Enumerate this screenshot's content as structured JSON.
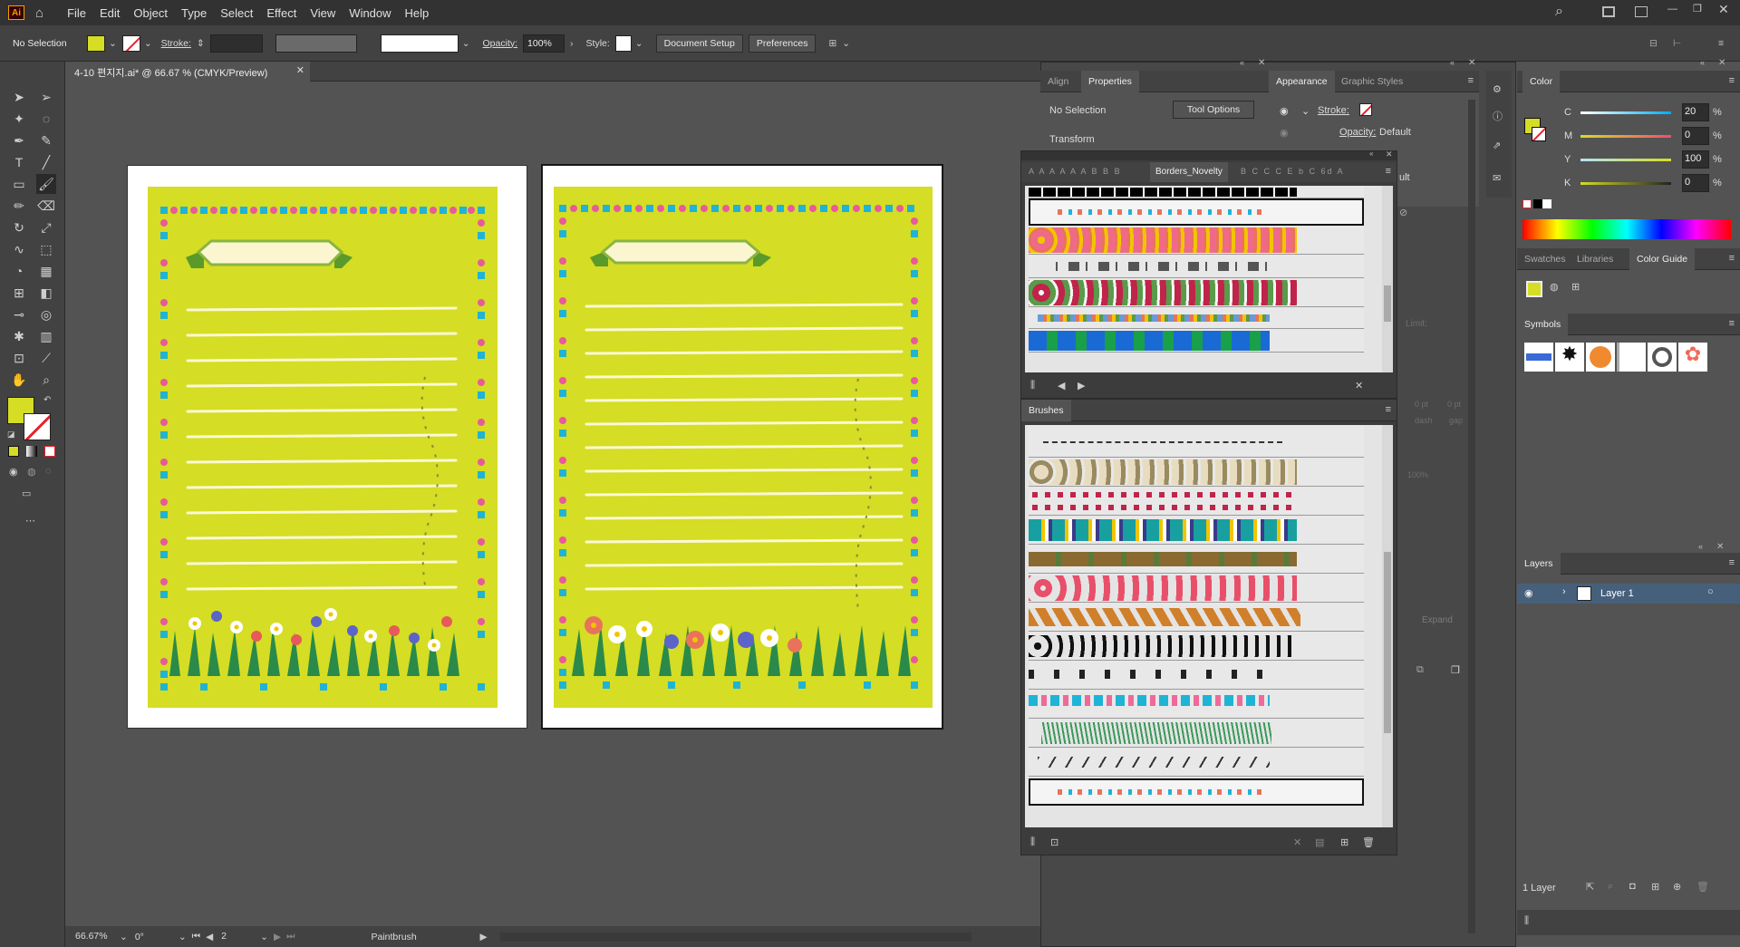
{
  "app": {
    "logo": "Ai",
    "home_icon": "home-icon"
  },
  "menu": [
    "File",
    "Edit",
    "Object",
    "Type",
    "Select",
    "Effect",
    "View",
    "Window",
    "Help"
  ],
  "control": {
    "selection": "No Selection",
    "stroke_label": "Stroke:",
    "opacity_label": "Opacity:",
    "opacity_value": "100%",
    "style_label": "Style:",
    "doc_setup": "Document Setup",
    "preferences": "Preferences"
  },
  "document": {
    "tab_title": "4-10 편지지.ai* @ 66.67 % (CMYK/Preview)"
  },
  "status": {
    "zoom": "66.67%",
    "rotate": "0°",
    "artboard": "2",
    "tool": "Paintbrush"
  },
  "properties": {
    "tab_align": "Align",
    "tab_properties": "Properties",
    "no_selection": "No Selection",
    "tool_options": "Tool Options",
    "transform": "Transform"
  },
  "appearance": {
    "tab_appearance": "Appearance",
    "tab_graphic_styles": "Graphic Styles",
    "stroke": "Stroke:",
    "opacity": "Opacity:",
    "opacity_value": "Default",
    "partial": "ult"
  },
  "borders": {
    "tab_label": "Borders_Novelty",
    "left_tabs": "A A A A A A B B B",
    "right_tabs": "B C C C E b C 6d A"
  },
  "brushes": {
    "title": "Brushes"
  },
  "color": {
    "title": "Color",
    "c_label": "C",
    "c_value": "20",
    "m_label": "M",
    "m_value": "0",
    "y_label": "Y",
    "y_value": "100",
    "k_label": "K",
    "k_value": "0",
    "pct": "%",
    "fill": "#d5dd24"
  },
  "swatches": {
    "tab_swatches": "Swatches",
    "tab_libraries": "Libraries",
    "tab_color_guide": "Color Guide"
  },
  "symbols": {
    "title": "Symbols"
  },
  "layers": {
    "title": "Layers",
    "layer_name": "Layer 1",
    "count": "1 Layer"
  },
  "ghost": {
    "limit": "Limit:",
    "expand": "Expand",
    "pt1": "0 pt",
    "pt2": "0 pt",
    "dash": "dash",
    "gap": "gap",
    "pct": "100%"
  }
}
